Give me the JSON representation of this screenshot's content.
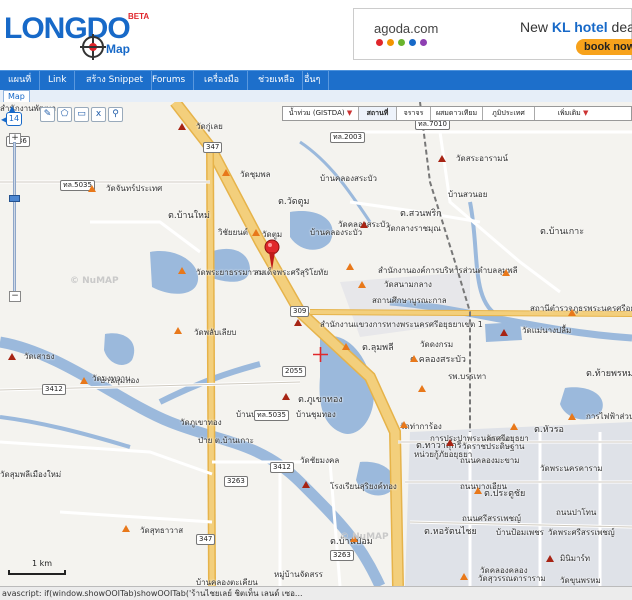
{
  "header": {
    "logo_text": "LONGDO",
    "logo_badge": "BETA",
    "logo_sub": "Map",
    "ad": {
      "brand": "agoda.com",
      "headline_prefix": "New ",
      "headline_accent": "KL hotel",
      "headline_suffix": " dea",
      "button": "book now",
      "dot_colors": [
        "#e0252b",
        "#f29400",
        "#6ab42d",
        "#1769c8",
        "#8e3fb2"
      ]
    }
  },
  "nav": {
    "items": [
      "แผนที่",
      "Link",
      "สร้าง Snippet",
      "Forums",
      "เครื่องมือ",
      "ช่วยเหลือ",
      "อื่นๆ"
    ]
  },
  "tab": {
    "label": "Map"
  },
  "map": {
    "zoom_level": "14",
    "zoom_plus": "+",
    "zoom_minus": "−",
    "tools": [
      "✎",
      "⬠",
      "▭",
      "x",
      "⚲"
    ],
    "layers": {
      "base_select": "น้ำท่วม (GISTDA)",
      "active": "สถานที่",
      "traffic": "จราจร",
      "satellite": "ผสมดาวเทียม",
      "terrain": "ภูมิประเทศ",
      "more": "เพิ่มเติม"
    },
    "scale_label": "1 km",
    "watermark": "© NuMAP",
    "colors": {
      "land": "#f4f3ef",
      "water": "#9bb9dc",
      "major_road": "#f0c970",
      "minor_road": "#ffffff",
      "urban": "#dcdfe6",
      "railway": "#555555"
    },
    "route_shields": [
      "347",
      "4036",
      "ทล.2003",
      "ทล.7010",
      "ทล.5035",
      "309",
      "2055",
      "3412",
      "3263",
      "ทล.5035",
      "347",
      "3412",
      "3263"
    ],
    "labels": [
      "วัดกู่เลย",
      "วัดชุมพล",
      "ต.วัดตูม",
      "บ้านคลองสระบัว",
      "บ้านคลองระบัว",
      "ต.บ้านใหม่",
      "วิชัยยนต์",
      "วัดตูม",
      "วัดคลองสระบัว",
      "วัดพระยาธรรมาวาส",
      "สมเด็จพระศรีสุริโยทัย",
      "ต.สวนพริก",
      "บ้านสวนอย",
      "ต.บ้านเกาะ",
      "วัดจันทร์ประเทศ",
      "วัดสระอารามน์",
      "วัดกลางราชมุณ",
      "สำนักงานองค์การบริหารส่วนตำบลลุมพลี",
      "วัดสนามกลาง",
      "สถานศึกษาบูรณะกาล",
      "สถานีตำรวจภูธรพระนครศรีอยุธยา",
      "สำนักงานแขวงการทางพระนครศรีอยุธยาเขต 1",
      "ต.ลุมพลี",
      "วัดดงกรม",
      "ต.คลองสระบัว",
      "วัดแม่นางปลื้ม",
      "วัดพลับเลียบ",
      "วัดเสาธง",
      "บ้านสุมทอง",
      "วัดมงทวาน",
      "บ้านชุมทอง",
      "ต.ภูเขาทอง",
      "วัดภูเขาทอง",
      "ป่าย ต.บ้านเกาะ",
      "บ้านปมอม",
      "วัดชัยมงคล",
      "โรงเรียนสุริยงค์ทอง",
      "วัดท่าการ้อง",
      "การไฟฟ้าส่วนภูมิภาคพระนครศรีอยุธยา",
      "ต.หัวรอ",
      "วัดเสนา",
      "หน่วยกู้ภัยอยุธยา",
      "ต.ทาวาสุกรี",
      "วัดราชประดิษฐาน",
      "ถนนคลองมะขาม",
      "ถนนบางเอียน",
      "ถนนศรีสรรเพชญ์",
      "ถนนปาโทน",
      "ต.หอรัตนไชย",
      "ต.ประตูชัย",
      "บ้านป้อมเพชร",
      "วัดพระศรีสรรเพชญ์",
      "วัดสุทธาวาส",
      "หมู่บ้านจัดสรร",
      "บ้านคลองตะเคียน",
      "ต.บ้านป้อม",
      "วัดคลองคลอง",
      "วัดสุวรรณดาราราม",
      "มินิมาร์ท",
      "วัดขุนพรหม",
      "วัดพระนครคาราม",
      "วัดสุมพลีเมืองใหม่",
      "ต.ท้ายพรหม",
      "รพ.บรรเทา",
      "การประปาพระนครศรีอยุธยา",
      "สำนักงานพัฒนา"
    ]
  },
  "statusbar": {
    "text": "avascript: if(window.showOOITab)showOOITab('ร้านไชยเลย์ ชิตเท็น เลนด์ เซอ..."
  }
}
